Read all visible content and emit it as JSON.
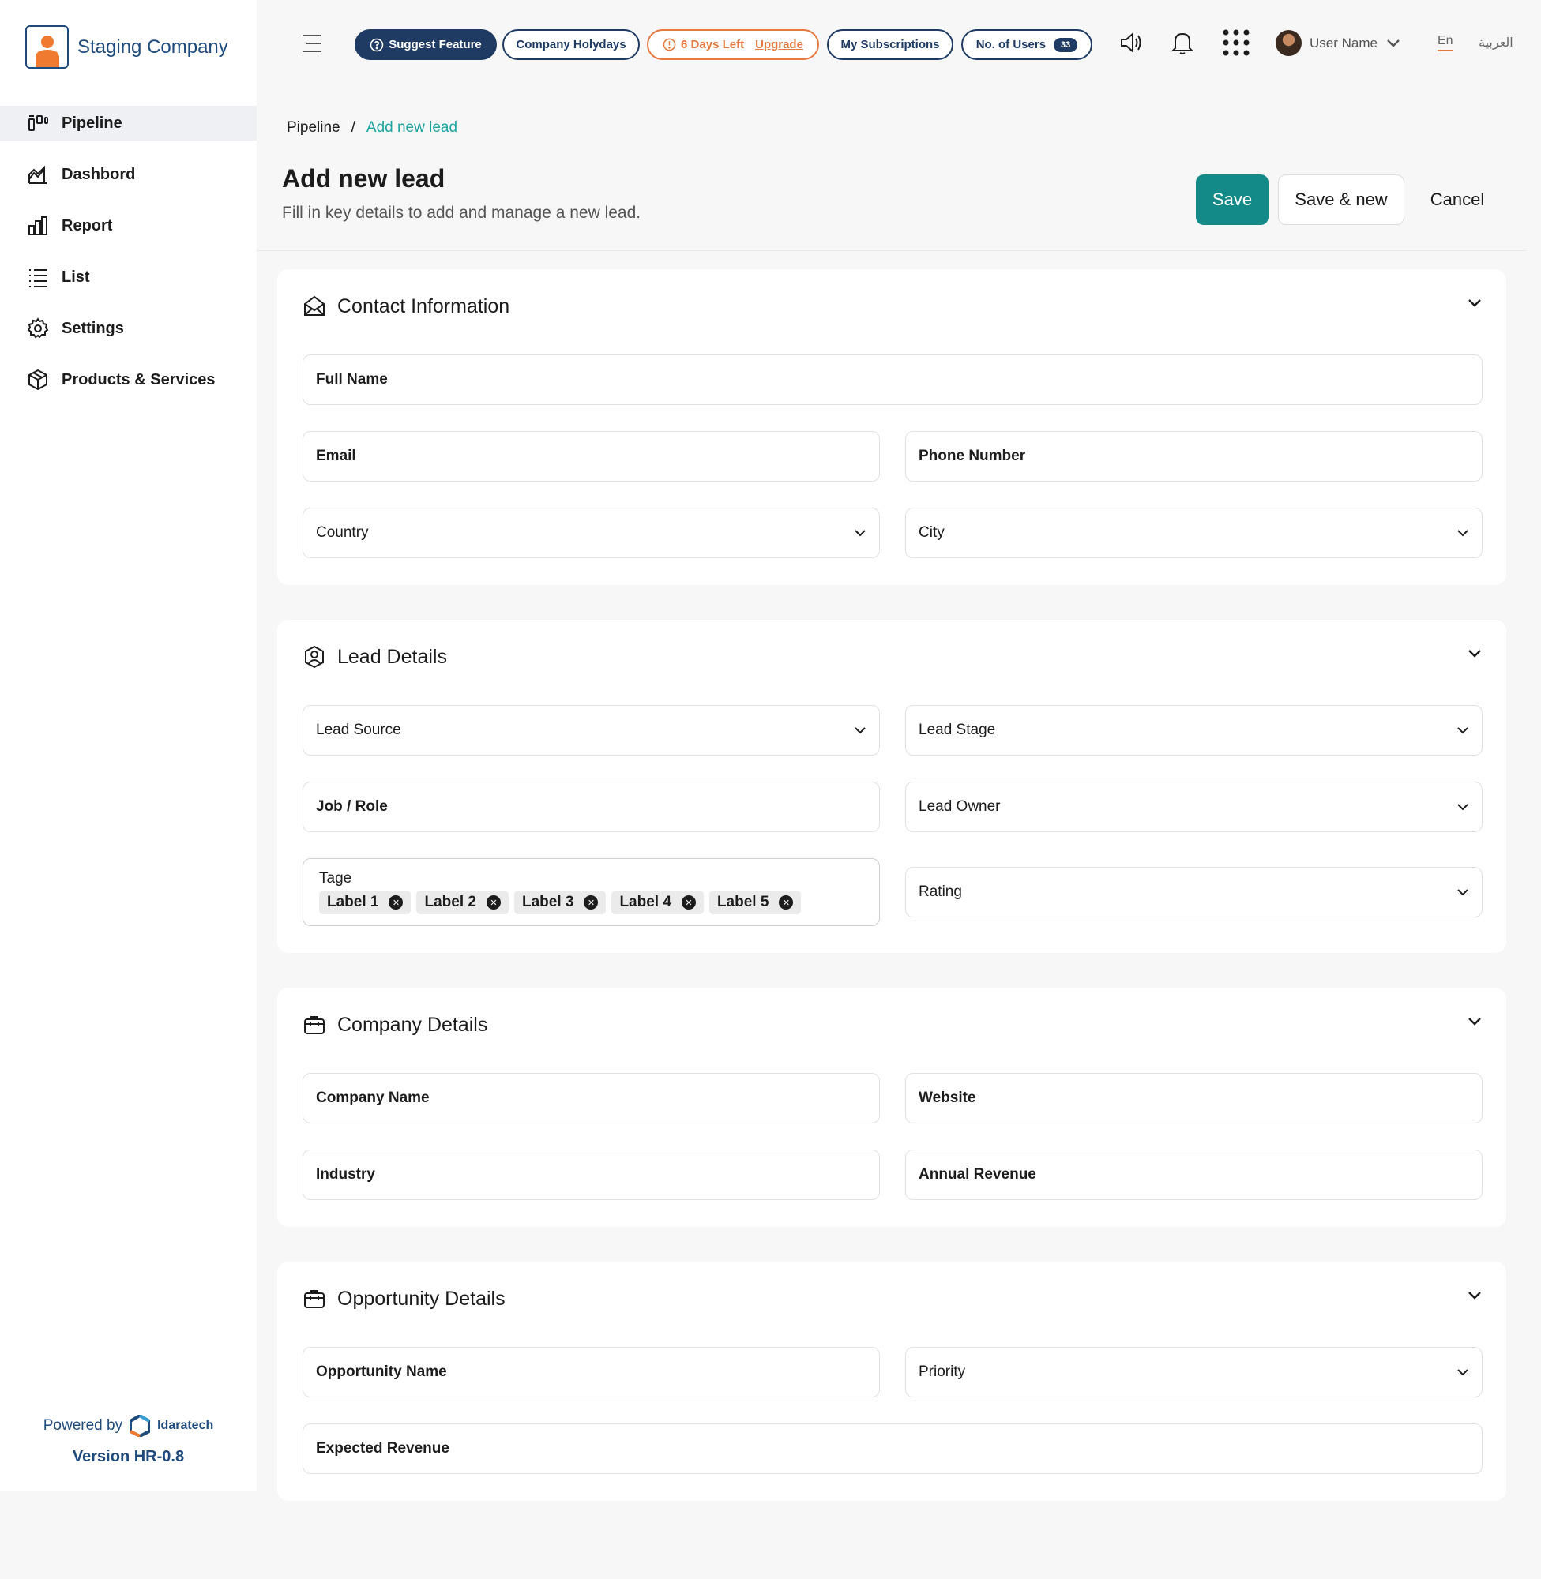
{
  "sidebar": {
    "brand": "Staging Company",
    "items": [
      {
        "label": "Pipeline",
        "icon": "pipeline-icon"
      },
      {
        "label": "Dashbord",
        "icon": "dashboard-icon"
      },
      {
        "label": "Report",
        "icon": "report-icon"
      },
      {
        "label": "List",
        "icon": "list-icon"
      },
      {
        "label": "Settings",
        "icon": "gear-icon"
      },
      {
        "label": "Products & Services",
        "icon": "box-icon"
      }
    ],
    "powered_by": "Powered by",
    "powered_brand": "Idaratech",
    "version": "Version HR-0.8"
  },
  "topbar": {
    "suggest_feature": "Suggest Feature",
    "company_holidays": "Company Holydays",
    "days_left": "6 Days Left",
    "upgrade": "Upgrade",
    "subscriptions": "My Subscriptions",
    "users_label": "No. of Users",
    "users_count": "33",
    "user_name": "User Name",
    "lang_en": "En",
    "lang_ar": "العربية"
  },
  "breadcrumb": {
    "root": "Pipeline",
    "separator": "/",
    "current": "Add new lead"
  },
  "header": {
    "title": "Add new lead",
    "subtitle": "Fill in key details to add and manage a new lead.",
    "save": "Save",
    "save_new": "Save & new",
    "cancel": "Cancel"
  },
  "contact": {
    "title": "Contact Information",
    "full_name": "Full Name",
    "email": "Email",
    "phone": "Phone Number",
    "country": "Country",
    "city": "City"
  },
  "lead": {
    "title": "Lead Details",
    "source": "Lead Source",
    "stage": "Lead Stage",
    "job": "Job / Role",
    "owner": "Lead Owner",
    "tags_label": "Tage",
    "tags": [
      "Label 1",
      "Label 2",
      "Label 3",
      "Label 4",
      "Label 5"
    ],
    "rating": "Rating"
  },
  "company": {
    "title": "Company Details",
    "name": "Company Name",
    "website": "Website",
    "industry": "Industry",
    "revenue": "Annual Revenue"
  },
  "opportunity": {
    "title": "Opportunity Details",
    "name": "Opportunity Name",
    "priority": "Priority",
    "expected": "Expected Revenue"
  },
  "colors": {
    "primary": "#138a87",
    "navy": "#1f3b63",
    "warning": "#e5793f",
    "brand_orange": "#f07a30"
  }
}
